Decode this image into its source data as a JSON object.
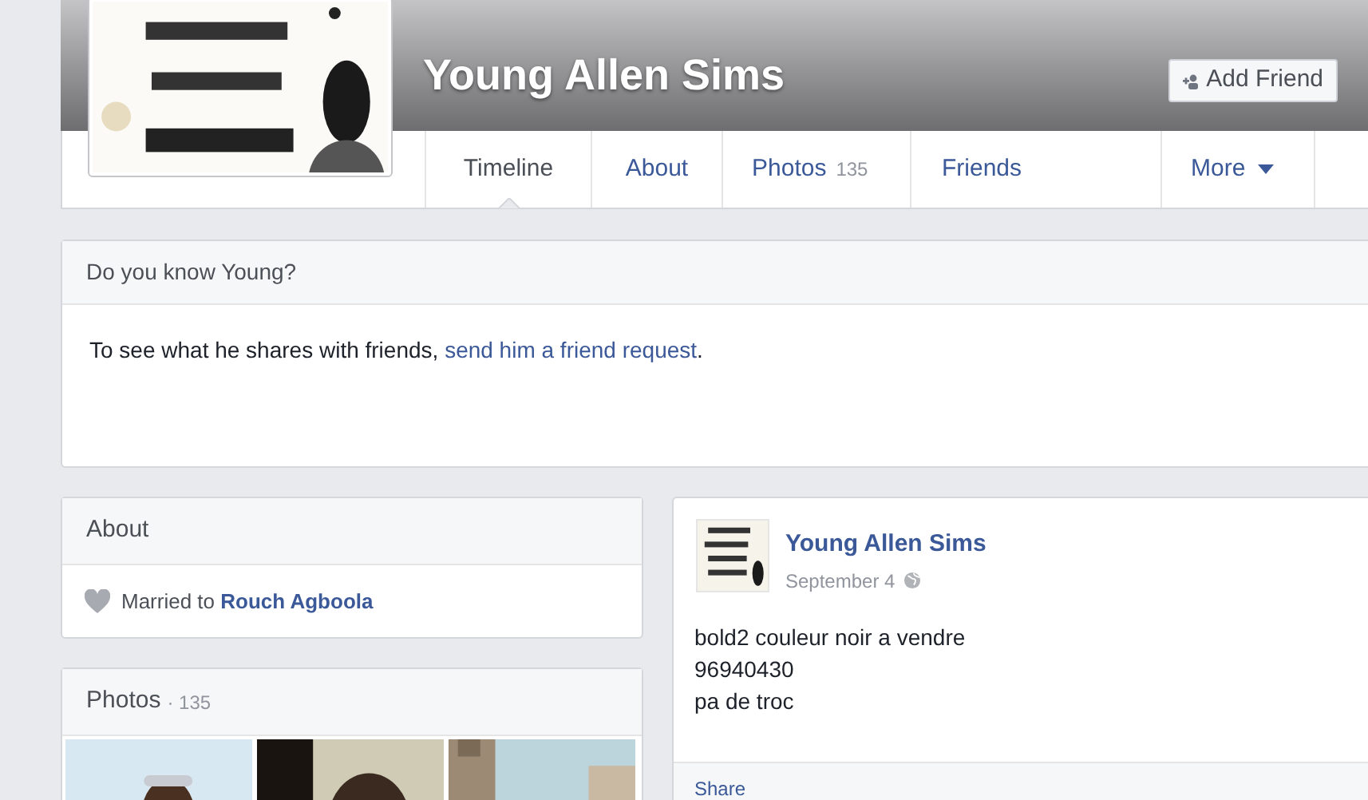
{
  "profile": {
    "name": "Young Allen Sims"
  },
  "actions": [
    {
      "label": "Add Friend"
    }
  ],
  "tabs": [
    {
      "label": "Timeline",
      "kind": "link",
      "selected": true
    },
    {
      "label": "About",
      "kind": "link",
      "selected": false
    },
    {
      "label": "Photos",
      "count": "135",
      "kind": "link",
      "selected": false
    },
    {
      "label": "Friends",
      "kind": "link",
      "selected": false
    },
    {
      "label": "More",
      "kind": "menu",
      "selected": false
    }
  ],
  "know_card": {
    "title": "Do you know Young?",
    "text_before": "To see what he shares with friends,",
    "link": "send him a friend request",
    "text_after": "."
  },
  "about": {
    "title": "About",
    "items": [
      {
        "text": "Married to",
        "link": "Rouch Agboola"
      }
    ]
  },
  "photos": {
    "title": "Photos",
    "count": "· 135"
  },
  "post": {
    "author": "Young Allen Sims",
    "date": "September 4",
    "lines": [
      "bold2 couleur noir a vendre",
      "96940430",
      "pa de troc"
    ],
    "actions": [
      "Share"
    ]
  }
}
